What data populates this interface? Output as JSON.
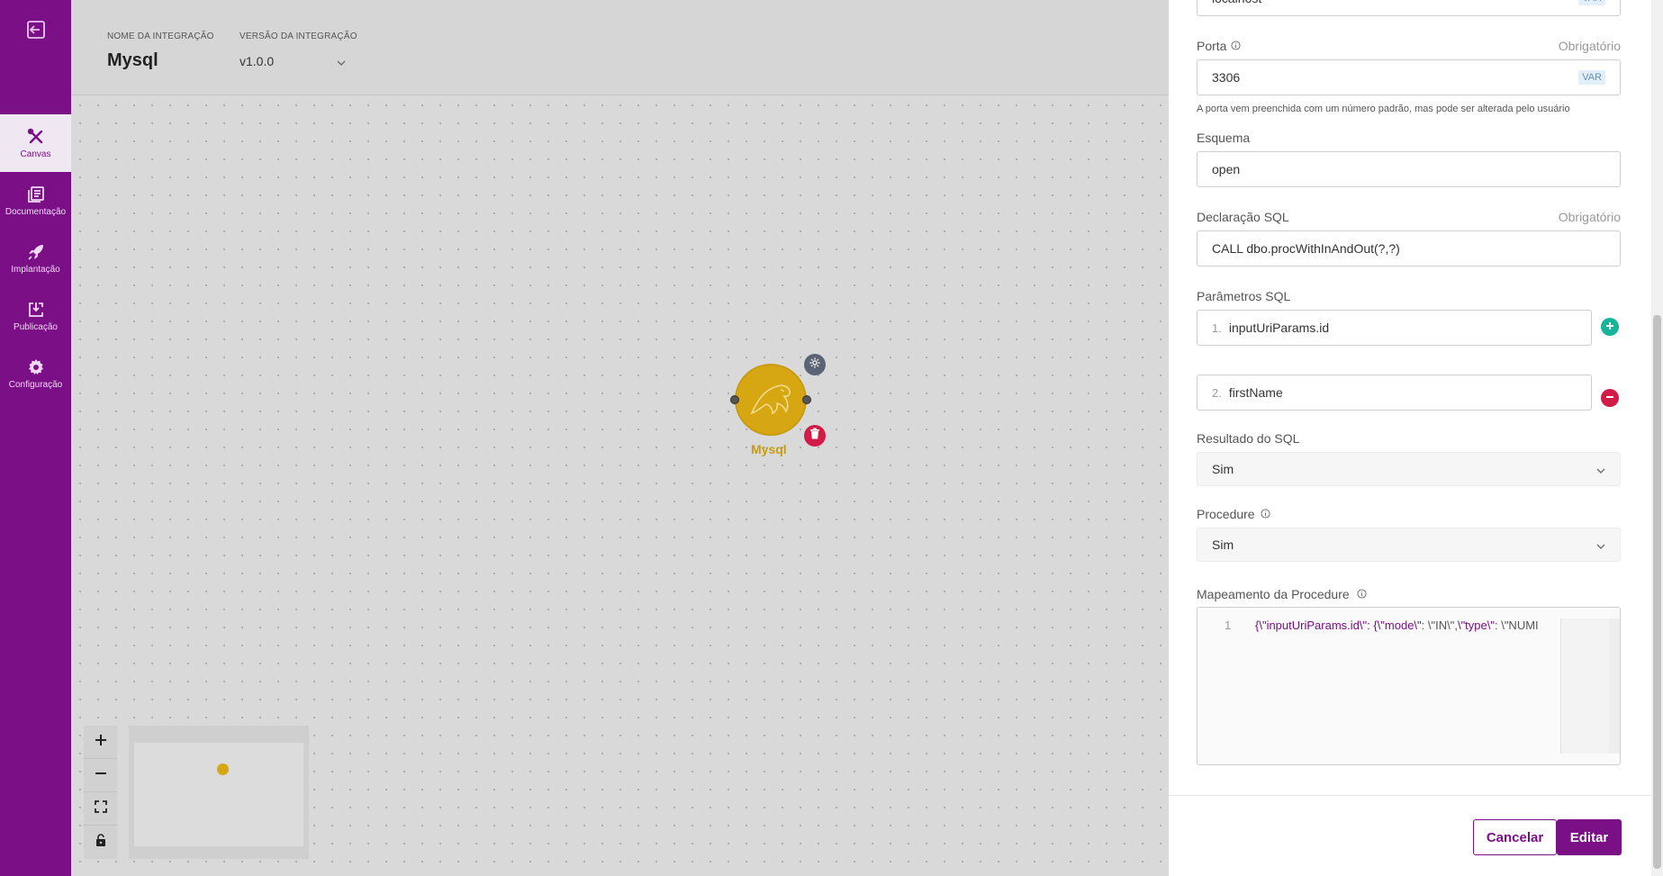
{
  "sidebar": {
    "exit_icon": "exit-icon",
    "items": [
      {
        "label": "Canvas",
        "icon": "canvas-tools-icon",
        "active": true
      },
      {
        "label": "Documentação",
        "icon": "document-icon"
      },
      {
        "label": "Implantação",
        "icon": "rocket-icon"
      },
      {
        "label": "Publicação",
        "icon": "download-box-icon"
      },
      {
        "label": "Configuração",
        "icon": "gear-icon"
      }
    ]
  },
  "header": {
    "name_label": "NOME DA INTEGRAÇÃO",
    "name_value": "Mysql",
    "version_label": "VERSÃO DA INTEGRAÇÃO",
    "version_value": "v1.0.0"
  },
  "canvas": {
    "node_label": "Mysql",
    "zoom_in": "+",
    "zoom_out": "—"
  },
  "panel": {
    "host_value": "localhost",
    "var_badge": "VAR",
    "port_label": "Porta",
    "required": "Obrigatório",
    "port_value": "3306",
    "port_hint": "A porta vem preenchida com um número padrão, mas pode ser alterada pelo usuário",
    "schema_label": "Esquema",
    "schema_value": "open",
    "sql_label": "Declaração SQL",
    "sql_value": "CALL dbo.procWithInAndOut(?,?)",
    "params_label": "Parâmetros SQL",
    "params": [
      {
        "num": "1.",
        "value": "inputUriParams.id"
      },
      {
        "num": "2.",
        "value": "firstName"
      }
    ],
    "result_label": "Resultado do SQL",
    "result_value": "Sim",
    "procedure_label": "Procedure",
    "procedure_value": "Sim",
    "mapping_label": "Mapeamento da Procedure",
    "code_line_num": "1",
    "code_key": "{\\\"inputUriParams.id\\\": {\\\"mode\\\"",
    "code_rest1": ": \\\"IN\\\",",
    "code_key2": "\\\"type\\\"",
    "code_rest2": ": \\\"NUMI",
    "cancel": "Cancelar",
    "edit": "Editar"
  }
}
